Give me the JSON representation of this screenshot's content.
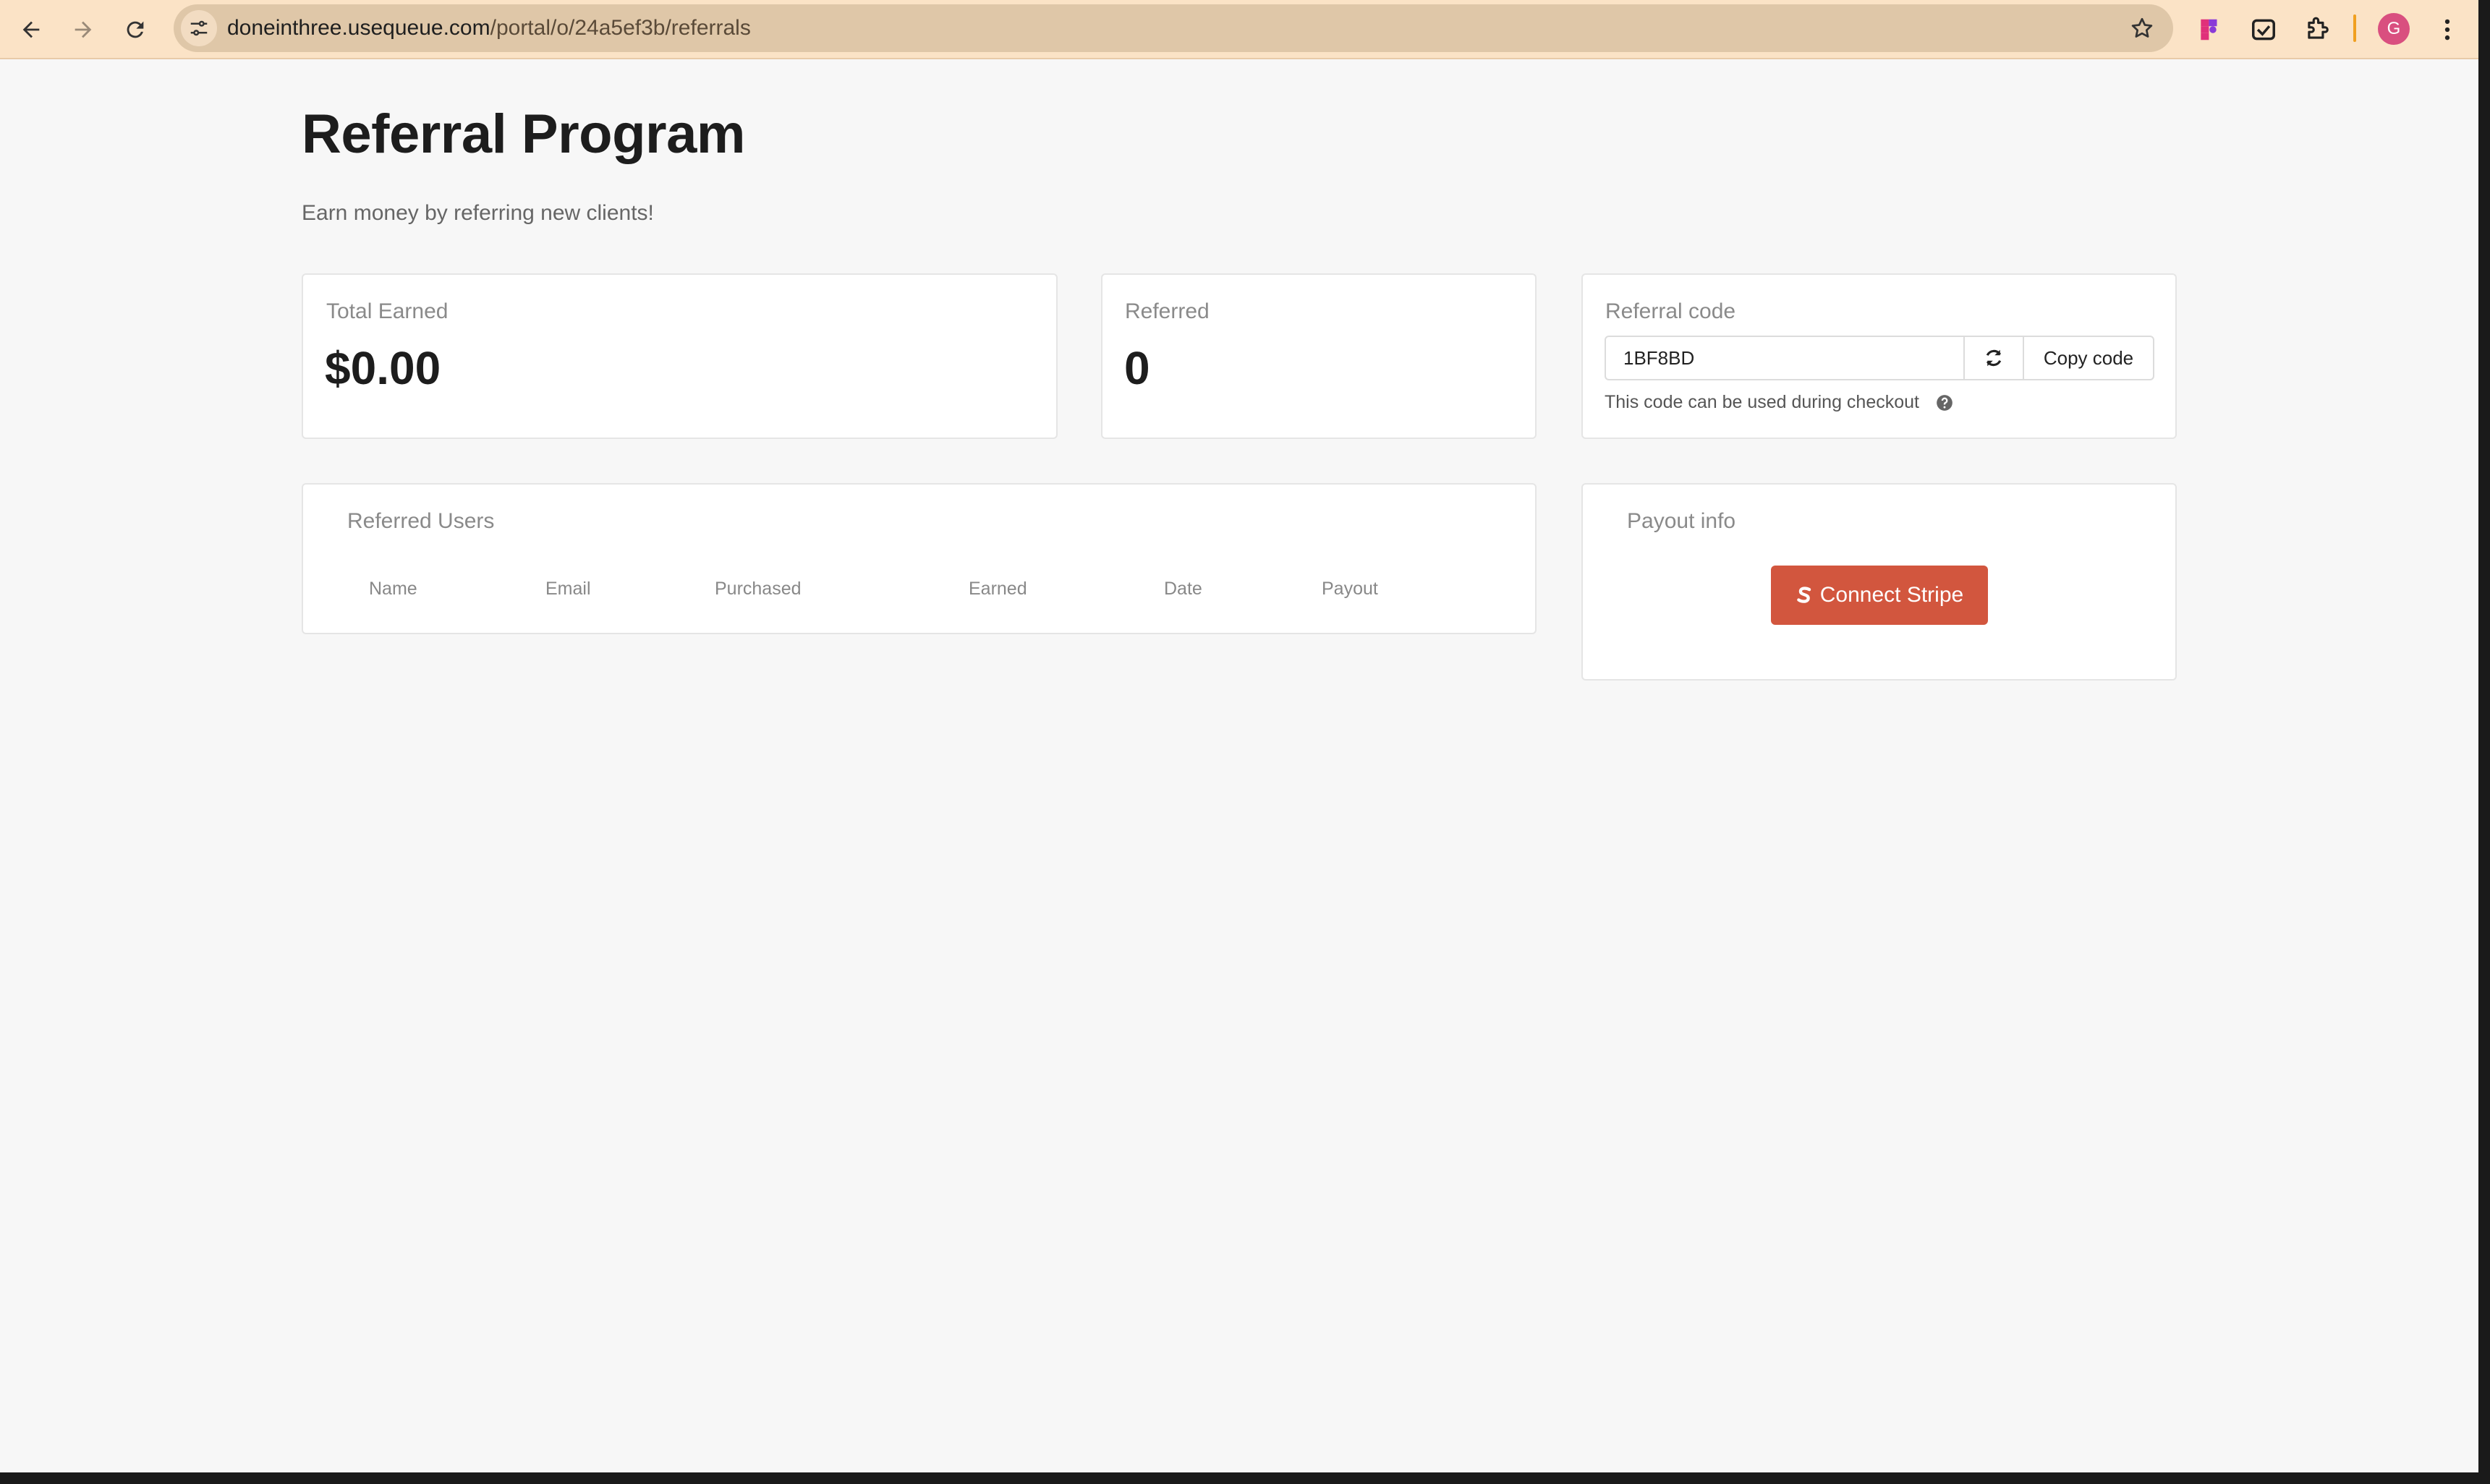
{
  "browser": {
    "url_host": "doneinthree.usequeue.com",
    "url_path": "/portal/o/24a5ef3b/referrals",
    "profile_initial": "G",
    "icons": {
      "back": "arrow-left-icon",
      "forward": "arrow-right-icon",
      "reload": "reload-icon",
      "site_info": "tune-icon",
      "bookmark": "star-icon",
      "extensions": [
        "figma-icon",
        "screenshot-icon",
        "puzzle-icon"
      ],
      "menu": "kebab-menu-icon"
    },
    "colors": {
      "toolbar": "#fbe3c6",
      "omnibox": "#dfc7a8",
      "avatar": "#d94f7f"
    }
  },
  "page": {
    "title": "Referral Program",
    "subtitle": "Earn money by referring new clients!"
  },
  "stats": {
    "total_earned": {
      "label": "Total Earned",
      "value": "$0.00"
    },
    "referred": {
      "label": "Referred",
      "value": "0"
    }
  },
  "referral_code": {
    "label": "Referral code",
    "code": "1BF8BD",
    "copy_label": "Copy code",
    "hint": "This code can be used during checkout"
  },
  "referred_users": {
    "title": "Referred Users",
    "columns": [
      "Name",
      "Email",
      "Purchased",
      "Earned",
      "Date",
      "Payout"
    ],
    "rows": []
  },
  "payout": {
    "title": "Payout info",
    "connect_label": "Connect Stripe",
    "button_color": "#d2563e"
  }
}
